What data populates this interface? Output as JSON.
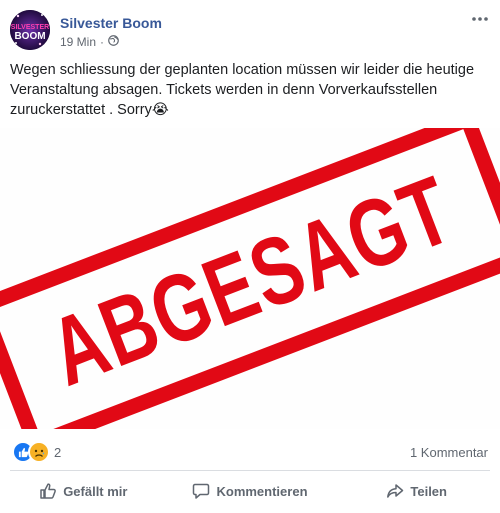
{
  "post": {
    "page_name": "Silvester Boom",
    "time": "19 Min",
    "separator": "·",
    "audience_icon": "globe-icon",
    "text": "Wegen schliessung der geplanten location müssen wir leider die heutige Veranstaltung absagen. Tickets werden in denn Vorverkaufsstellen zuruckerstattet . Sorry😭",
    "avatar_text_1": "SILVESTER",
    "avatar_text_2": "BOOM",
    "stamp_text": "ABGESAGT",
    "stamp_color": "#e10915",
    "reaction_icons": [
      "like-icon",
      "sad-icon"
    ],
    "reaction_count": "2",
    "comments_count": "1 Kommentar",
    "actions": [
      {
        "label": "Gefällt mir",
        "icon": "thumbs-up-icon"
      },
      {
        "label": "Kommentieren",
        "icon": "comment-icon"
      },
      {
        "label": "Teilen",
        "icon": "share-icon"
      }
    ]
  },
  "colors": {
    "link": "#385898",
    "muted": "#606770",
    "like_blue": "#1877f2",
    "sad_yellow": "#f7b125"
  }
}
